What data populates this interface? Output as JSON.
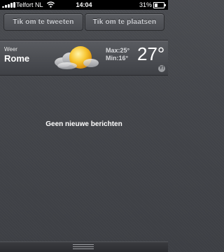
{
  "status_bar": {
    "carrier": "Telfort NL",
    "time": "14:04",
    "battery_percent": "31%",
    "battery_level": 0.31,
    "signal_bars": 5
  },
  "share": {
    "tweet_label": "Tik om te tweeten",
    "post_label": "Tik om te plaatsen"
  },
  "weather": {
    "label": "Weer",
    "city": "Rome",
    "max": "Max:25°",
    "min": "Min:16°",
    "temperature": "27°",
    "condition_icon": "sun-behind-cloud-icon",
    "provider_icon": "yahoo-icon",
    "provider_glyph": "Y!"
  },
  "notifications": {
    "empty_message": "Geen nieuwe berichten"
  },
  "colors": {
    "background": "#44464b",
    "sun": "#f7c531",
    "text": "#ffffff"
  }
}
